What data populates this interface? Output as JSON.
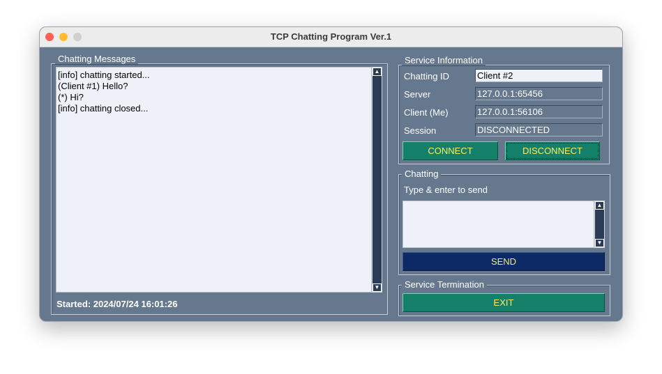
{
  "window": {
    "title": "TCP Chatting Program Ver.1"
  },
  "messages": {
    "legend": "Chatting Messages",
    "lines": [
      "[info]  chatting started...",
      "(Client #1) Hello?",
      "(*) Hi?",
      "[info]  chatting closed..."
    ],
    "started": "Started: 2024/07/24 16:01:26"
  },
  "service": {
    "legend": "Service Information",
    "chatting_id_label": "Chatting ID",
    "chatting_id": "Client #2",
    "server_label": "Server",
    "server": "127.0.0.1:65456",
    "client_label": "Client (Me)",
    "client": "127.0.0.1:56106",
    "session_label": "Session",
    "session": "DISCONNECTED",
    "connect": "CONNECT",
    "disconnect": "DISCONNECT"
  },
  "chatting": {
    "legend": "Chatting",
    "hint": "Type & enter to send",
    "input": "",
    "send": "SEND"
  },
  "termination": {
    "legend": "Service Termination",
    "exit": "EXIT"
  },
  "colors": {
    "bg": "#66788e",
    "green": "#15806a",
    "navy": "#0e2a66",
    "btn_text": "#f5f06a"
  }
}
